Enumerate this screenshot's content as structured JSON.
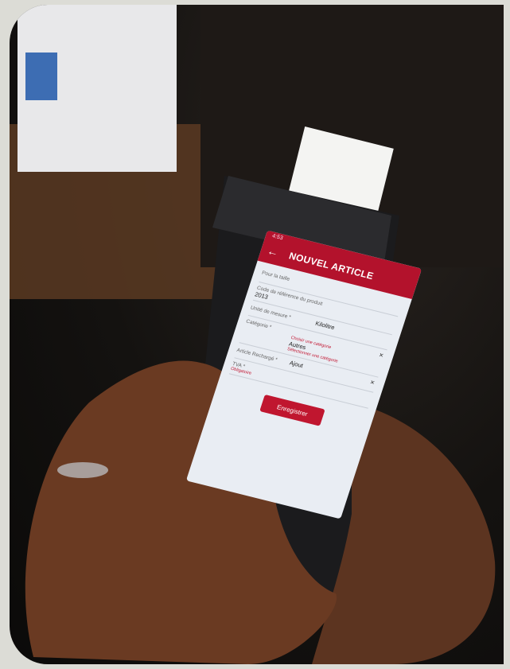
{
  "status_time": "4:53",
  "app_title": "NOUVEL ARTICLE",
  "form": {
    "field1_label": "Pour la taille",
    "field2_label": "Code de référence du produit",
    "field2_value": "2013",
    "field3_label": "Unité de mesure *",
    "field3_value": "Kilolitre",
    "category_label": "Catégorie *",
    "category_hint": "Choisir une catégorie",
    "category_value": "Autres",
    "category_error": "Sélectionner une catégorie",
    "article_label": "Article Rechargé *",
    "article_value": "Ajout",
    "field6_label": "TVA *",
    "field6_hint": "Obligatoire"
  },
  "save_button": "Enregistrer",
  "colors": {
    "appbar": "#b3122c",
    "button": "#c0162f"
  }
}
